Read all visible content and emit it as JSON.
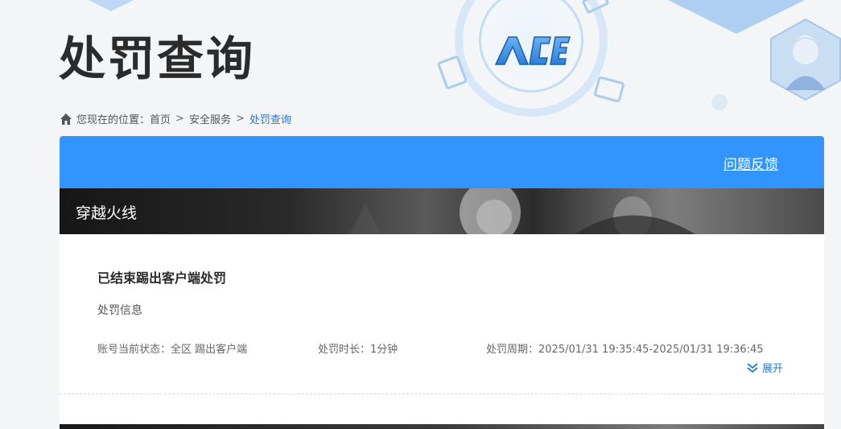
{
  "header": {
    "title": "处罚查询",
    "logo_text": "ACE"
  },
  "breadcrumb": {
    "prefix": "您现在的位置：",
    "items": [
      "首页",
      "安全服务",
      "处罚查询"
    ],
    "separator": ">"
  },
  "toolbar": {
    "feedback_label": "问题反馈"
  },
  "game": {
    "name": "穿越火线"
  },
  "record": {
    "title": "已结束踢出客户端处罚",
    "section_label": "处罚信息",
    "status": "账号当前状态：全区 踢出客户端",
    "duration": "处罚时长：1分钟",
    "period": "处罚周期：2025/01/31 19:35:45-2025/01/31 19:36:45",
    "expand_label": "展开"
  },
  "colors": {
    "accent": "#3294ff",
    "link": "#2a78c8",
    "page_bg": "#f4f5f7"
  },
  "icons": {
    "home": "home-icon",
    "expand": "double-chevron-down-icon"
  }
}
